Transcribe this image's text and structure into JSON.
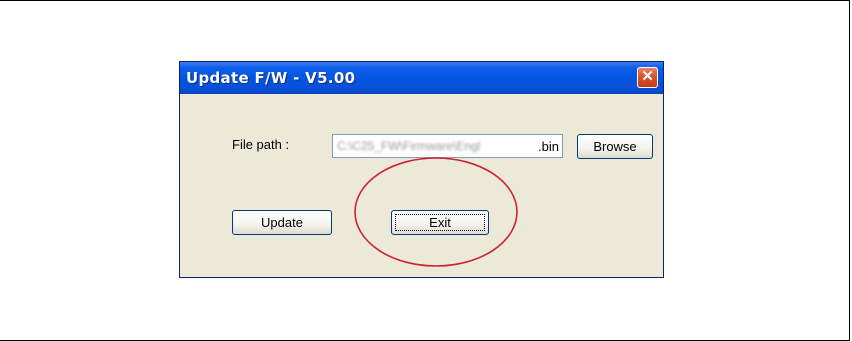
{
  "dialog": {
    "title": "Update F/W - V5.00",
    "close_symbol": "✕"
  },
  "file_path": {
    "label": "File path :",
    "value_obscured": "C:\\C25_FW\\Firmware\\Engl",
    "value_extension": ".bin"
  },
  "buttons": {
    "browse_label": "Browse",
    "update_label": "Update",
    "exit_label": "Exit"
  },
  "colors": {
    "titlebar": "#0354e0",
    "dialog_bg": "#ece9d8",
    "annotation_ellipse": "#cc2233"
  }
}
